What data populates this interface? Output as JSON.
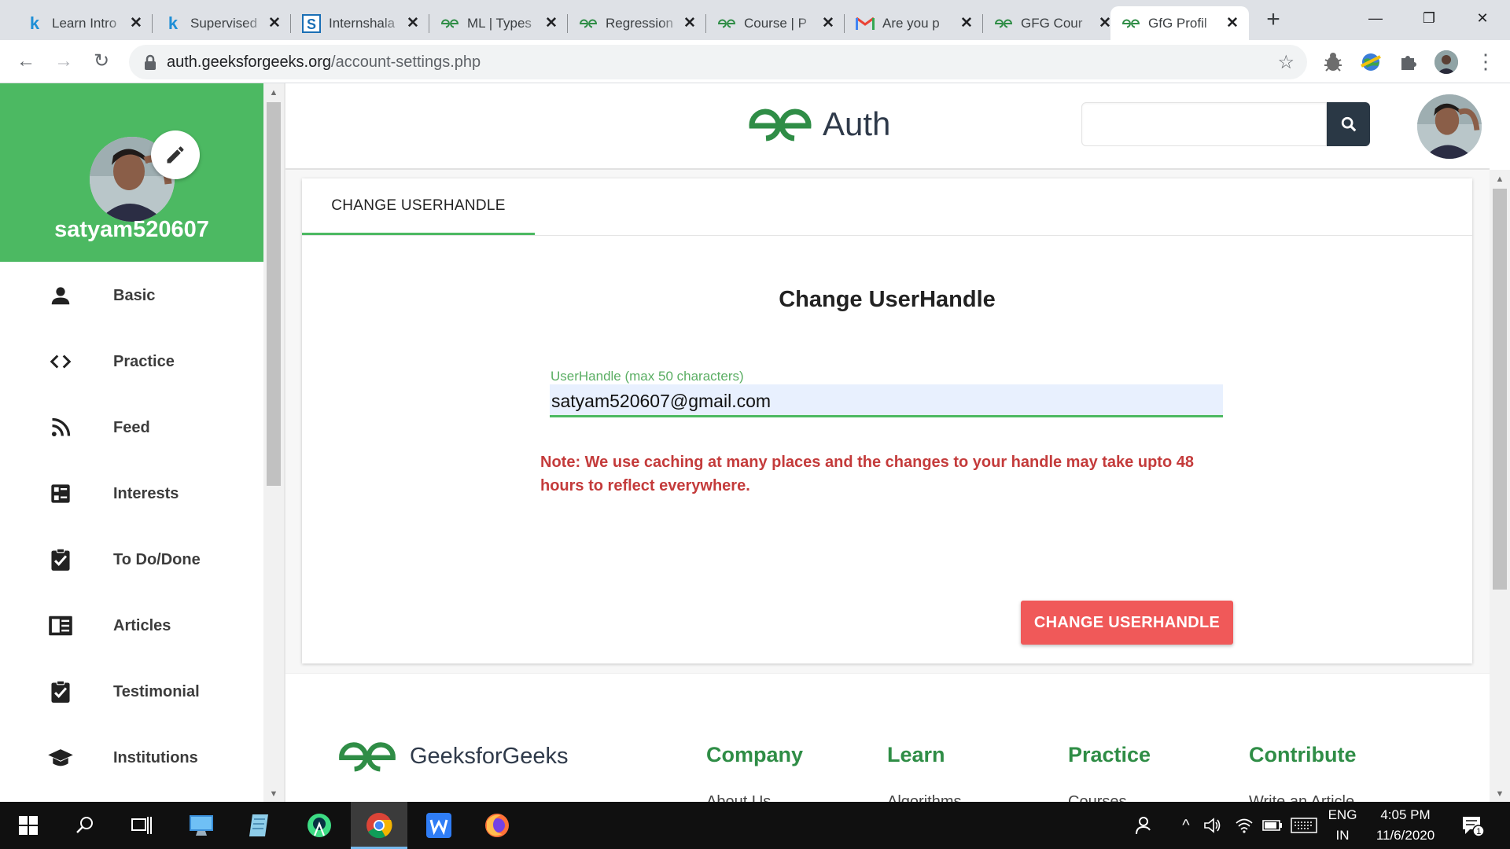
{
  "browser": {
    "tabs": [
      {
        "title": "Learn Intro",
        "favicon": "k-icon"
      },
      {
        "title": "Supervised",
        "favicon": "k-icon"
      },
      {
        "title": "Internshala",
        "favicon": "internshala-icon"
      },
      {
        "title": "ML | Types",
        "favicon": "gfg-icon"
      },
      {
        "title": "Regression",
        "favicon": "gfg-icon"
      },
      {
        "title": "Course | P",
        "favicon": "gfg-icon"
      },
      {
        "title": "Are you p",
        "favicon": "gmail-icon"
      },
      {
        "title": "GFG Cour",
        "favicon": "gfg-icon"
      },
      {
        "title": "GfG Profil",
        "favicon": "gfg-icon"
      }
    ],
    "active_tab": 8,
    "url_host": "auth.geeksforgeeks.org",
    "url_path": "/account-settings.php"
  },
  "sidebar": {
    "username": "satyam520607",
    "items": [
      {
        "label": "Basic",
        "icon": "person-icon"
      },
      {
        "label": "Practice",
        "icon": "code-icon"
      },
      {
        "label": "Feed",
        "icon": "rss-icon"
      },
      {
        "label": "Interests",
        "icon": "list-icon"
      },
      {
        "label": "To Do/Done",
        "icon": "clipboard-check-icon"
      },
      {
        "label": "Articles",
        "icon": "article-icon"
      },
      {
        "label": "Testimonial",
        "icon": "clipboard-check-icon"
      },
      {
        "label": "Institutions",
        "icon": "graduation-cap-icon"
      }
    ]
  },
  "header": {
    "brand": "Auth",
    "search_value": ""
  },
  "card": {
    "tab_label": "CHANGE USERHANDLE",
    "title": "Change UserHandle",
    "field_label": "UserHandle (max 50 characters)",
    "field_value": "satyam520607@gmail.com",
    "note": "Note: We use caching at many places and the changes to your handle may take upto 48 hours to reflect everywhere.",
    "button_label": "CHANGE USERHANDLE"
  },
  "footer": {
    "brand": "GeeksforGeeks",
    "columns": [
      {
        "title": "Company",
        "first_item": "About Us"
      },
      {
        "title": "Learn",
        "first_item": "Algorithms"
      },
      {
        "title": "Practice",
        "first_item": "Courses"
      },
      {
        "title": "Contribute",
        "first_item": "Write an Article"
      }
    ]
  },
  "taskbar": {
    "lang_top": "ENG",
    "lang_bottom": "IN",
    "time": "4:05 PM",
    "date": "11/6/2020",
    "notification_count": "1"
  },
  "colors": {
    "gfg_green": "#4cb962",
    "footer_green": "#2f8d46",
    "note_red": "#c43b3b",
    "button_red": "#f05959",
    "search_button": "#2a3845"
  }
}
